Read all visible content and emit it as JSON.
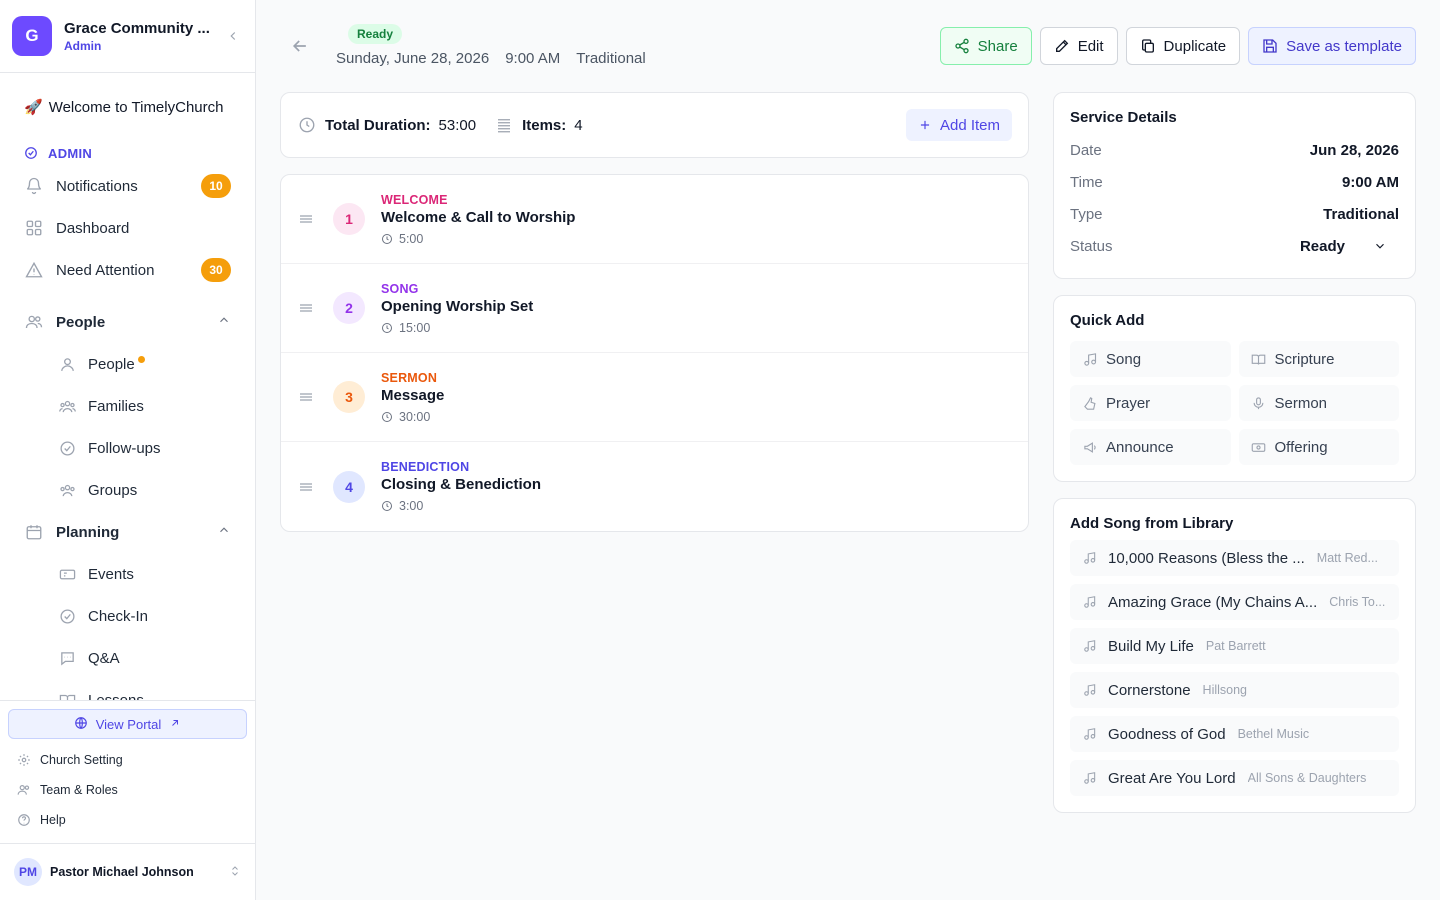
{
  "org": {
    "initial": "G",
    "name": "Grace Community ...",
    "role": "Admin"
  },
  "sidebar": {
    "welcome": "Welcome to TimelyChurch",
    "welcome_emoji": "🚀",
    "admin_label": "ADMIN",
    "items": [
      {
        "label": "Notifications",
        "badge": "10",
        "icon": "bell-icon"
      },
      {
        "label": "Dashboard",
        "icon": "grid-icon"
      },
      {
        "label": "Need Attention",
        "badge": "30",
        "icon": "warning-icon"
      }
    ],
    "people_group": {
      "label": "People",
      "items": [
        "People",
        "Families",
        "Follow-ups",
        "Groups"
      ]
    },
    "planning_group": {
      "label": "Planning",
      "items": [
        "Events",
        "Check-In",
        "Q&A",
        "Lessons"
      ]
    },
    "view_portal": "View Portal",
    "bottom_links": [
      "Church Setting",
      "Team & Roles",
      "Help"
    ],
    "user": {
      "initials": "PM",
      "name": "Pastor Michael Johnson"
    }
  },
  "header": {
    "status": "Ready",
    "date": "Sunday, June 28, 2026",
    "time": "9:00 AM",
    "type": "Traditional",
    "actions": {
      "share": "Share",
      "edit": "Edit",
      "duplicate": "Duplicate",
      "template": "Save as template"
    }
  },
  "summary": {
    "duration_label": "Total Duration:",
    "duration": "53:00",
    "items_label": "Items:",
    "items": "4",
    "add_item": "Add Item"
  },
  "service_items": [
    {
      "num": "1",
      "category": "WELCOME",
      "title": "Welcome & Call to Worship",
      "duration": "5:00",
      "color": "#db2777",
      "bg": "#fce7f3"
    },
    {
      "num": "2",
      "category": "SONG",
      "title": "Opening Worship Set",
      "duration": "15:00",
      "color": "#9333ea",
      "bg": "#f3e8ff"
    },
    {
      "num": "3",
      "category": "SERMON",
      "title": "Message",
      "duration": "30:00",
      "color": "#ea580c",
      "bg": "#ffedd5"
    },
    {
      "num": "4",
      "category": "BENEDICTION",
      "title": "Closing & Benediction",
      "duration": "3:00",
      "color": "#4f46e5",
      "bg": "#e0e7ff"
    }
  ],
  "details": {
    "title": "Service Details",
    "rows": [
      {
        "k": "Date",
        "v": "Jun 28, 2026"
      },
      {
        "k": "Time",
        "v": "9:00 AM"
      },
      {
        "k": "Type",
        "v": "Traditional"
      }
    ],
    "status_label": "Status",
    "status_value": "Ready"
  },
  "quick_add": {
    "title": "Quick Add",
    "items": [
      "Song",
      "Scripture",
      "Prayer",
      "Sermon",
      "Announce",
      "Offering"
    ]
  },
  "library": {
    "title": "Add Song from Library",
    "songs": [
      {
        "title": "10,000 Reasons (Bless the ...",
        "artist": "Matt Red..."
      },
      {
        "title": "Amazing Grace (My Chains A...",
        "artist": "Chris To..."
      },
      {
        "title": "Build My Life",
        "artist": "Pat Barrett"
      },
      {
        "title": "Cornerstone",
        "artist": "Hillsong"
      },
      {
        "title": "Goodness of God",
        "artist": "Bethel Music"
      },
      {
        "title": "Great Are You Lord",
        "artist": "All Sons & Daughters"
      }
    ]
  }
}
